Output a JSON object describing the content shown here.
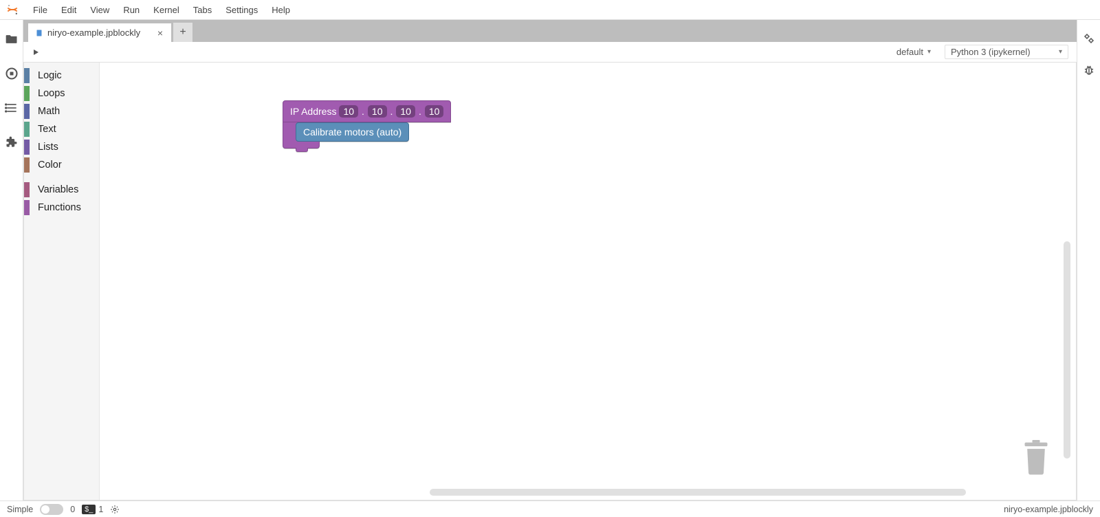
{
  "menubar": {
    "items": [
      "File",
      "Edit",
      "View",
      "Run",
      "Kernel",
      "Tabs",
      "Settings",
      "Help"
    ]
  },
  "tab": {
    "title": "niryo-example.jpblockly"
  },
  "toolbar": {
    "mode": {
      "label": "default"
    },
    "kernel": {
      "label": "Python 3 (ipykernel)"
    }
  },
  "toolbox": {
    "categories": [
      {
        "label": "Logic",
        "color": "#5b80a5"
      },
      {
        "label": "Loops",
        "color": "#5ba55b"
      },
      {
        "label": "Math",
        "color": "#5b67a5"
      },
      {
        "label": "Text",
        "color": "#5ba58c"
      },
      {
        "label": "Lists",
        "color": "#745ba5"
      },
      {
        "label": "Color",
        "color": "#a5745b"
      }
    ],
    "categories2": [
      {
        "label": "Variables",
        "color": "#a55b80"
      },
      {
        "label": "Functions",
        "color": "#995ba5"
      }
    ]
  },
  "blocks": {
    "ip": {
      "label": "IP Address",
      "octets": [
        "10",
        "10",
        "10",
        "10"
      ]
    },
    "calibrate": {
      "label": "Calibrate motors (auto)"
    }
  },
  "statusbar": {
    "simple": "Simple",
    "count0": "0",
    "count1": "1",
    "filename": "niryo-example.jpblockly"
  }
}
